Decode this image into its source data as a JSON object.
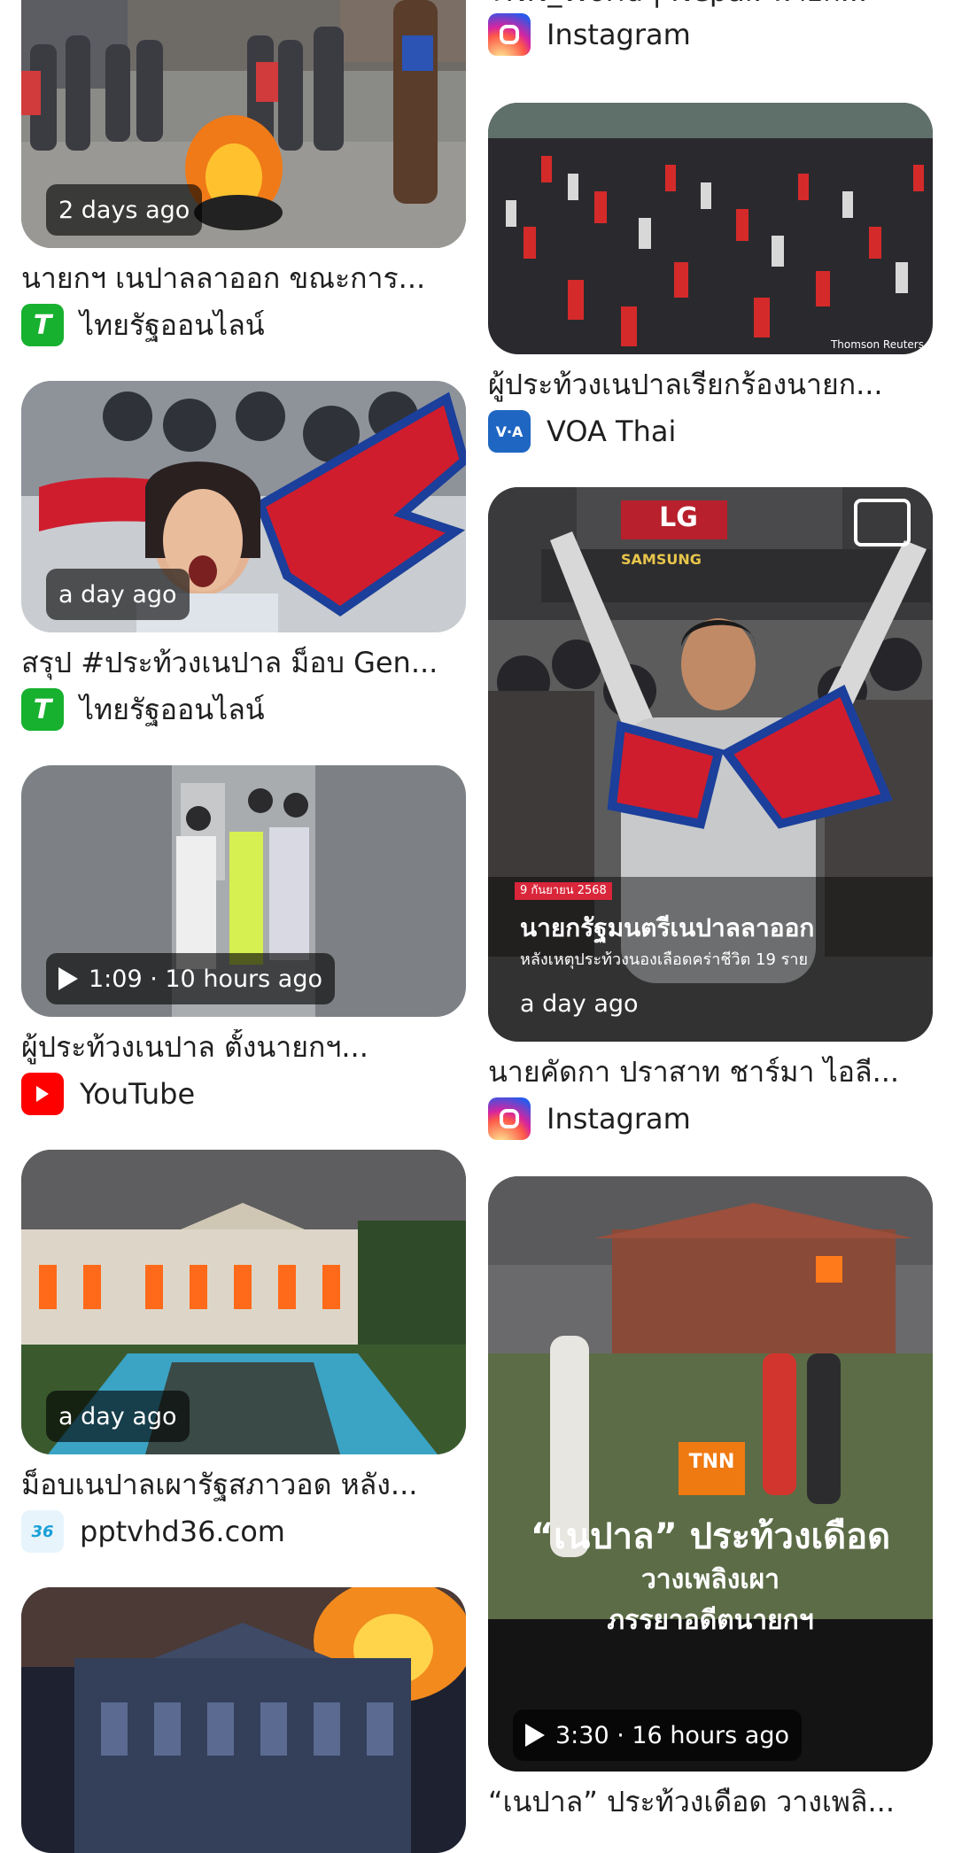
{
  "left_column": [
    {
      "badge": "2 days ago",
      "title": "นายกฯ เนปาลลาออก ขณะการ...",
      "source": "ไทยรัฐออนไลน์",
      "source_icon": "thairath-icon"
    },
    {
      "badge": "a day ago",
      "title": "สรุป #ประท้วงเนปาล ม็อบ Gen...",
      "source": "ไทยรัฐออนไลน์",
      "source_icon": "thairath-icon"
    },
    {
      "badge": "1:09 · 10 hours ago",
      "is_video": true,
      "title": "ผู้ประท้วงเนปาล ตั้งนายกฯ...",
      "source": "YouTube",
      "source_icon": "youtube-icon"
    },
    {
      "badge": "a day ago",
      "title": "ม็อบเนปาลเผารัฐสภาวอด หลัง...",
      "source": "pptvhd36.com",
      "source_icon": "pptv-icon"
    }
  ],
  "right_column": [
    {
      "title": "TNN_World | Nepal: นายก...",
      "source": "Instagram",
      "source_icon": "instagram-icon"
    },
    {
      "watermark": "Thomson Reuters",
      "title": "ผู้ประท้วงเนปาลเรียกร้องนายก...",
      "source": "VOA Thai",
      "source_icon": "voa-icon"
    },
    {
      "badge": "a day ago",
      "image_text": {
        "date": "9 กันยายน 2568",
        "headline": "นายกรัฐมนตรีเนปาลลาออก",
        "subline": "หลังเหตุประท้วงนองเลือดคร่าชีวิต 19 ราย",
        "signs": [
          "LG",
          "SAMSUNG"
        ]
      },
      "title": "นายคัดกา ปราสาท ชาร์มา ไอลี...",
      "source": "Instagram",
      "source_icon": "instagram-icon"
    },
    {
      "badge": "3:30 · 16 hours ago",
      "is_video": true,
      "image_text": {
        "logo": "TNN",
        "headline": "“เนปาล” ประท้วงเดือด",
        "line2": "วางเพลิงเผา",
        "line3": "ภรรยาอดีตนายกฯ"
      },
      "title": "“เนปาล” ประท้วงเดือด วางเพลิ..."
    }
  ],
  "colors": {
    "thairath": "#17b12f",
    "youtube": "#ff0000",
    "voa": "#1f66c2",
    "pptv": "#1aa0d8"
  }
}
